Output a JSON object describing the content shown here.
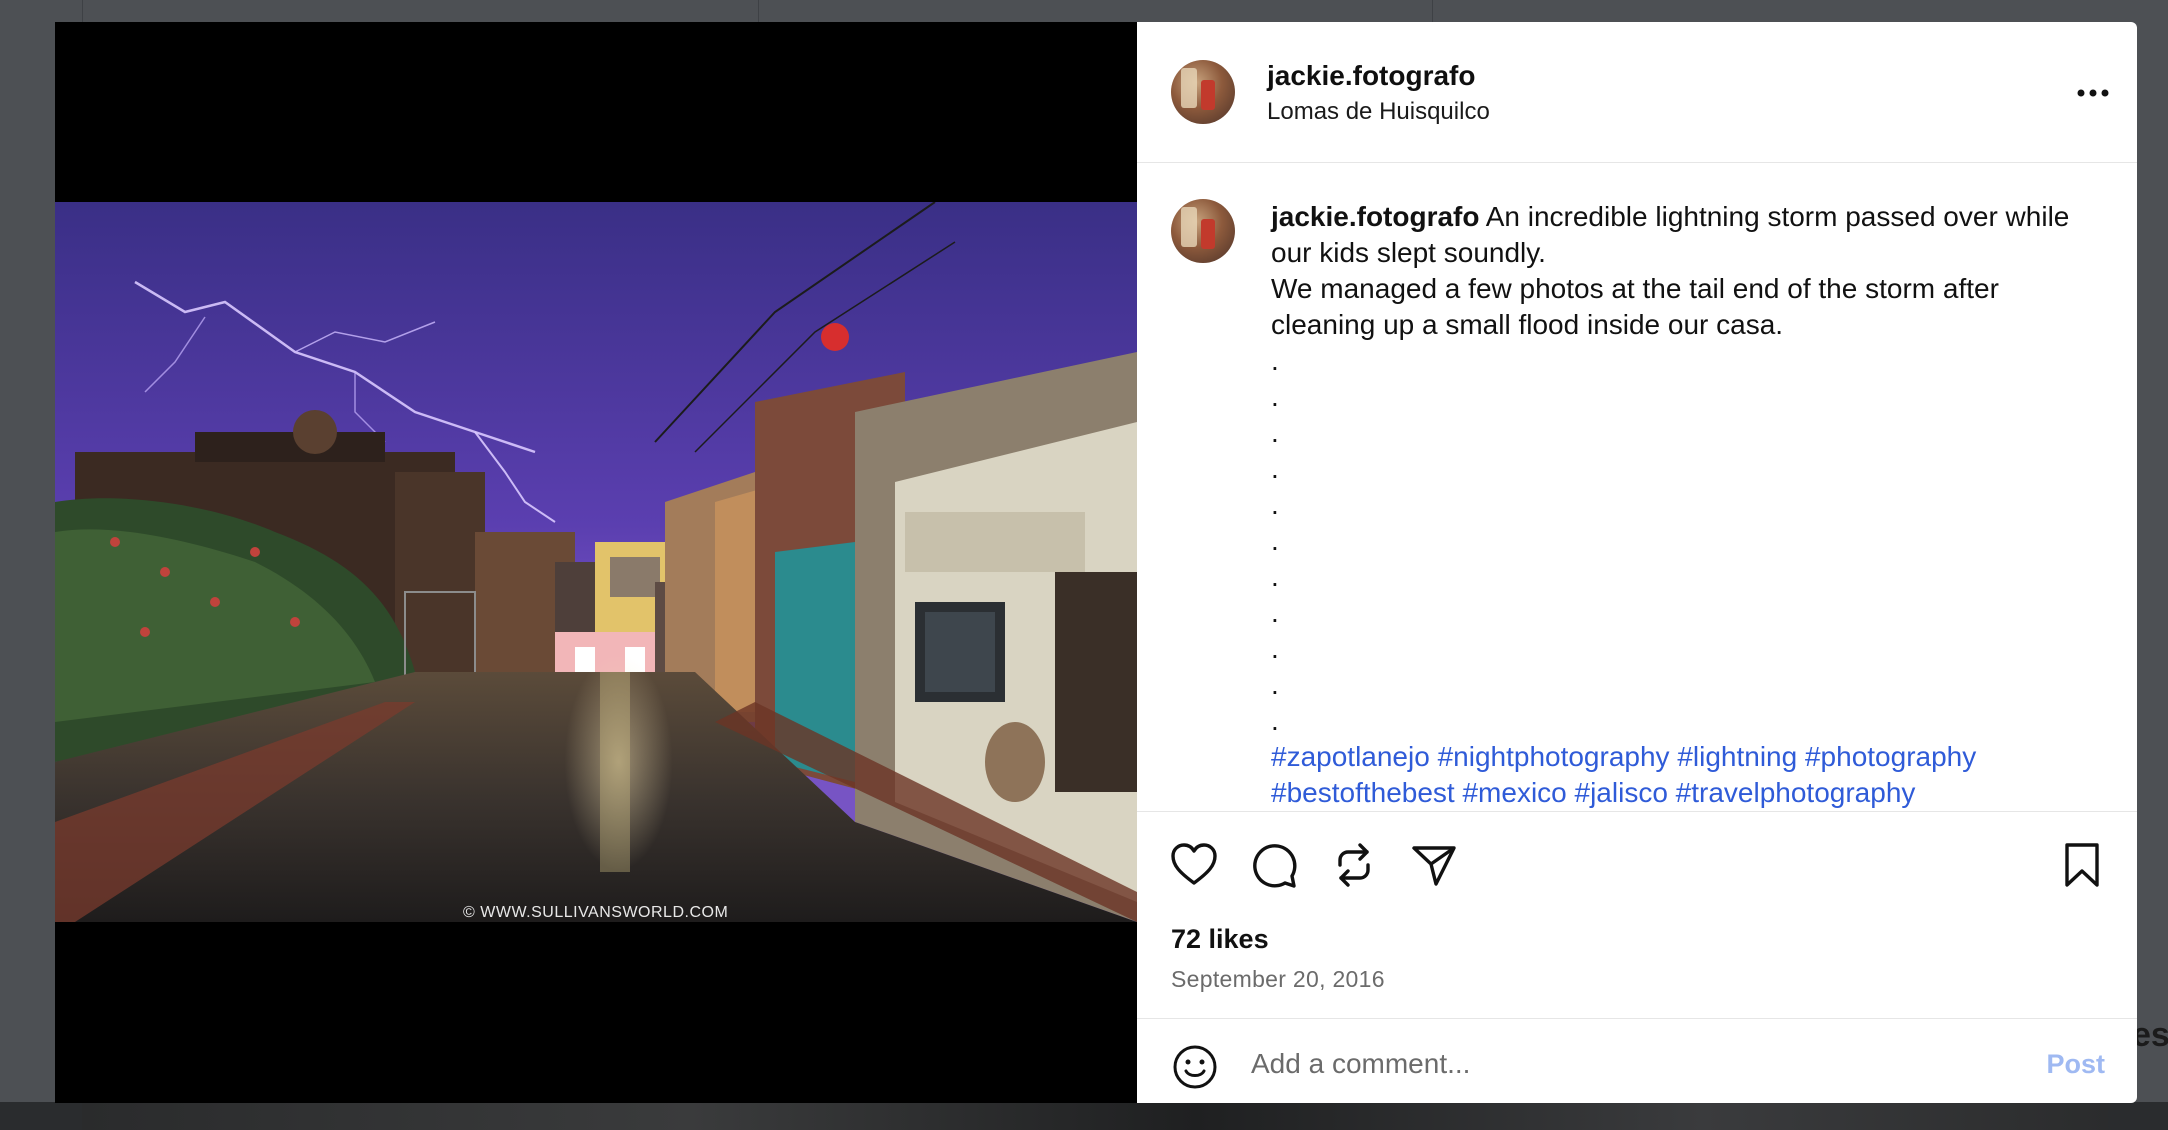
{
  "backdrop": {
    "side_text": "es"
  },
  "post": {
    "username": "jackie.fotografo",
    "location": "Lomas de Huisquilco",
    "watermark": "© WWW.SULLIVANSWORLD.COM",
    "caption": {
      "username": "jackie.fotografo",
      "line1": "An incredible lightning storm passed over while our kids slept soundly.",
      "line2": "We managed a few photos at the tail end of the storm after cleaning up a small flood inside our casa.",
      "dots": [
        ".",
        ".",
        ".",
        ".",
        ".",
        ".",
        ".",
        ".",
        ".",
        ".",
        "."
      ],
      "hashtags_line1": "#zapotlanejo #nightphotography #lightning #photography",
      "hashtags_line2": "#bestofthebest #mexico #jalisco #travelphotography"
    },
    "likes": "72 likes",
    "date": "September 20, 2016",
    "comment": {
      "placeholder": "Add a comment...",
      "post_label": "Post"
    }
  },
  "icons": {
    "more": "more-options-icon",
    "like": "heart-icon",
    "comment": "comment-icon",
    "share": "repost-icon",
    "send": "send-icon",
    "save": "bookmark-icon",
    "emoji": "emoji-icon"
  },
  "colors": {
    "accent": "#2f5bd8",
    "post_disabled": "#9fb9f2"
  }
}
